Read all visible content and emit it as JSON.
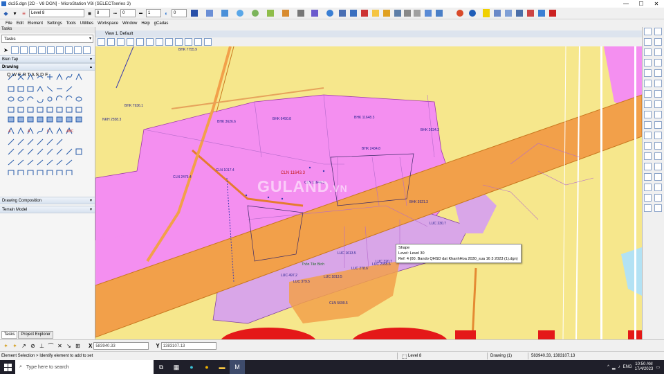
{
  "window": {
    "title": "dc35.dgn [2D - V8 DGN] - MicroStation V8i (SELECTseries 3)",
    "controls": [
      "—",
      "☐",
      "✕"
    ]
  },
  "toolbar": {
    "level_value": "Level 8",
    "color_value": "8",
    "style_value": "0",
    "weight_value": "1",
    "class_value": "0"
  },
  "menu": {
    "items": [
      "File",
      "Edit",
      "Element",
      "Settings",
      "Tools",
      "Utilities",
      "Workspace",
      "Window",
      "Help",
      "gCadas"
    ]
  },
  "left_panel": {
    "header": "Tasks",
    "task_select": "Tasks",
    "sections": [
      {
        "label": "Bien Tap",
        "bold": false
      },
      {
        "label": "Drawing",
        "bold": true
      },
      {
        "label": "Drawing Composition",
        "bold": false
      },
      {
        "label": "Terrain Model",
        "bold": false
      }
    ],
    "row_letters": [
      "Q",
      "W",
      "E",
      "R",
      "T",
      "A",
      "S",
      "D",
      "F"
    ],
    "tabs": [
      "Tasks",
      "Project Explorer"
    ]
  },
  "view": {
    "title": "View 1, Default"
  },
  "map": {
    "watermark_main": "GULAND",
    "watermark_suffix": ".VN",
    "place_name": "Thôn Tân Bình",
    "labels": [
      {
        "code": "BHK",
        "num": "7755.9"
      },
      {
        "code": "BHK",
        "num": "7936.1"
      },
      {
        "code": "NKH",
        "num": "2558.3"
      },
      {
        "code": "BHK",
        "num": "3626.6"
      },
      {
        "code": "BHK",
        "num": "6450.8"
      },
      {
        "code": "BHK",
        "num": "11648.3"
      },
      {
        "code": "BHK",
        "num": "2634.3"
      },
      {
        "code": "BHK",
        "num": "2434.8"
      },
      {
        "code": "CLN",
        "num": "2476.4"
      },
      {
        "code": "CLN",
        "num": "1017.4"
      },
      {
        "code": "CLN",
        "num": "11643.3"
      },
      {
        "code": "CLN",
        "num": "11644.3"
      },
      {
        "code": "BHK",
        "num": "3521.3"
      },
      {
        "code": "LUC",
        "num": "230.7"
      },
      {
        "code": "LUC",
        "num": "1613.5"
      },
      {
        "code": "LUC",
        "num": "2355.6"
      },
      {
        "code": "LUC",
        "num": "497.2"
      },
      {
        "code": "LUC",
        "num": "379.5"
      },
      {
        "code": "LUC",
        "num": "1813.5"
      },
      {
        "code": "LUC",
        "num": "278.6"
      },
      {
        "code": "LUC",
        "num": "320.7"
      },
      {
        "code": "CLN",
        "num": "5699.5"
      }
    ]
  },
  "tooltip": {
    "line1": "Shape",
    "line2": "Level: Level 30",
    "line3": "Ref: 4 (00. Bando QHSD dat KhanhHoa 2030_sua 16 3 2023 (1).dgn)"
  },
  "coords": {
    "x_label": "X",
    "x_value": "583940.33",
    "y_label": "Y",
    "y_value": "1383107.13"
  },
  "status": {
    "message": "Element Selection > Identify element to add to set",
    "level": "Level 8",
    "model": "Drawing (1)",
    "coord_readout": "583940.33, 1383107.13"
  },
  "taskbar": {
    "search_placeholder": "Type here to search",
    "time": "10:50 AM",
    "date": "17/4/2023",
    "lang": "ENG"
  },
  "colors": {
    "map_yellow": "#f6e78c",
    "map_magenta": "#f48ff0",
    "road_orange": "#f2a04a",
    "lilac": "#d9a6e8",
    "red_block": "#e41818",
    "water_blue": "#b3e2f4"
  }
}
